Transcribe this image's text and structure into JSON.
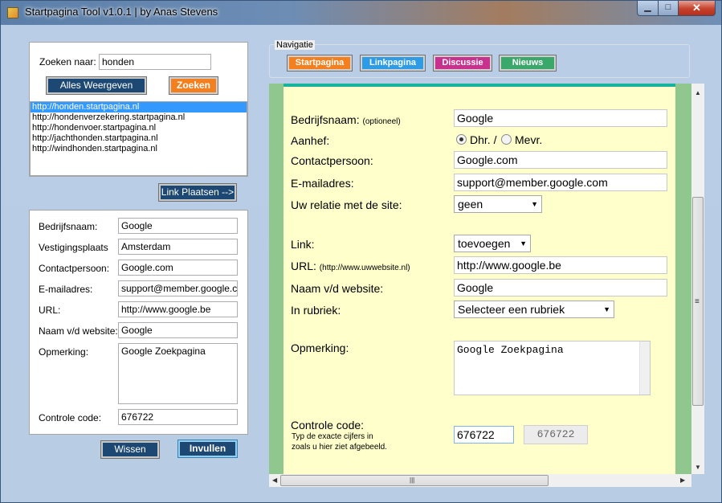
{
  "window": {
    "title": "Startpagina Tool v1.0.1 | by Anas Stevens",
    "min_glyph": "▁",
    "max_glyph": "□",
    "close_glyph": "✕"
  },
  "search": {
    "label": "Zoeken naar:",
    "value": "honden",
    "show_all": "Alles Weergeven",
    "search_btn": "Zoeken"
  },
  "results": [
    "http://honden.startpagina.nl",
    "http://hondenverzekering.startpagina.nl",
    "http://hondenvoer.startpagina.nl",
    "http://jachthonden.startpagina.nl",
    "http://windhonden.startpagina.nl"
  ],
  "place_link": "Link Plaatsen -->",
  "left_form": {
    "fields": [
      {
        "label": "Bedrijfsnaam:",
        "value": "Google"
      },
      {
        "label": "Vestigingsplaats",
        "value": "Amsterdam"
      },
      {
        "label": "Contactpersoon:",
        "value": "Google.com"
      },
      {
        "label": "E-mailadres:",
        "value": "support@member.google.com"
      },
      {
        "label": "URL:",
        "value": "http://www.google.be"
      },
      {
        "label": "Naam v/d website:",
        "value": "Google"
      }
    ],
    "remark_label": "Opmerking:",
    "remark_value": "Google Zoekpagina",
    "code_label": "Controle code:",
    "code_value": "676722"
  },
  "left_buttons": {
    "clear": "Wissen",
    "fill": "Invullen"
  },
  "navigation": {
    "title": "Navigatie",
    "buttons": [
      {
        "label": "Startpagina",
        "color": "#f47f1f"
      },
      {
        "label": "Linkpagina",
        "color": "#2e9be6"
      },
      {
        "label": "Discussie",
        "color": "#c8318e"
      },
      {
        "label": "Nieuws",
        "color": "#3aa86a"
      }
    ]
  },
  "web_form": {
    "company_label": "Bedrijfsnaam:",
    "company_note": "(optioneel)",
    "company_value": "Google",
    "salutation_label": "Aanhef:",
    "sal_mr": "Dhr. /",
    "sal_mrs": "Mevr.",
    "contact_label": "Contactpersoon:",
    "contact_value": "Google.com",
    "email_label": "E-mailadres:",
    "email_value": "support@member.google.com",
    "relation_label": "Uw relatie met de site:",
    "relation_value": "geen",
    "link_label": "Link:",
    "link_value": "toevoegen",
    "url_label": "URL:",
    "url_note": "(http://www.uwwebsite.nl)",
    "url_value": "http://www.google.be",
    "site_label": "Naam v/d website:",
    "site_value": "Google",
    "category_label": "In rubriek:",
    "category_value": "Selecteer een rubriek",
    "remark_label": "Opmerking:",
    "remark_value": "Google Zoekpagina",
    "code_label": "Controle code:",
    "code_hint_1": "Typ de exacte cijfers in",
    "code_hint_2": "zoals u hier ziet afgebeeld.",
    "code_value": "676722",
    "captcha": "676722"
  },
  "icons": {
    "dropdown": "▼",
    "scroll_up": "▲",
    "scroll_down": "▼",
    "scroll_left": "◀",
    "scroll_right": "▶",
    "grip_v": "≡",
    "grip_h": "|||"
  }
}
